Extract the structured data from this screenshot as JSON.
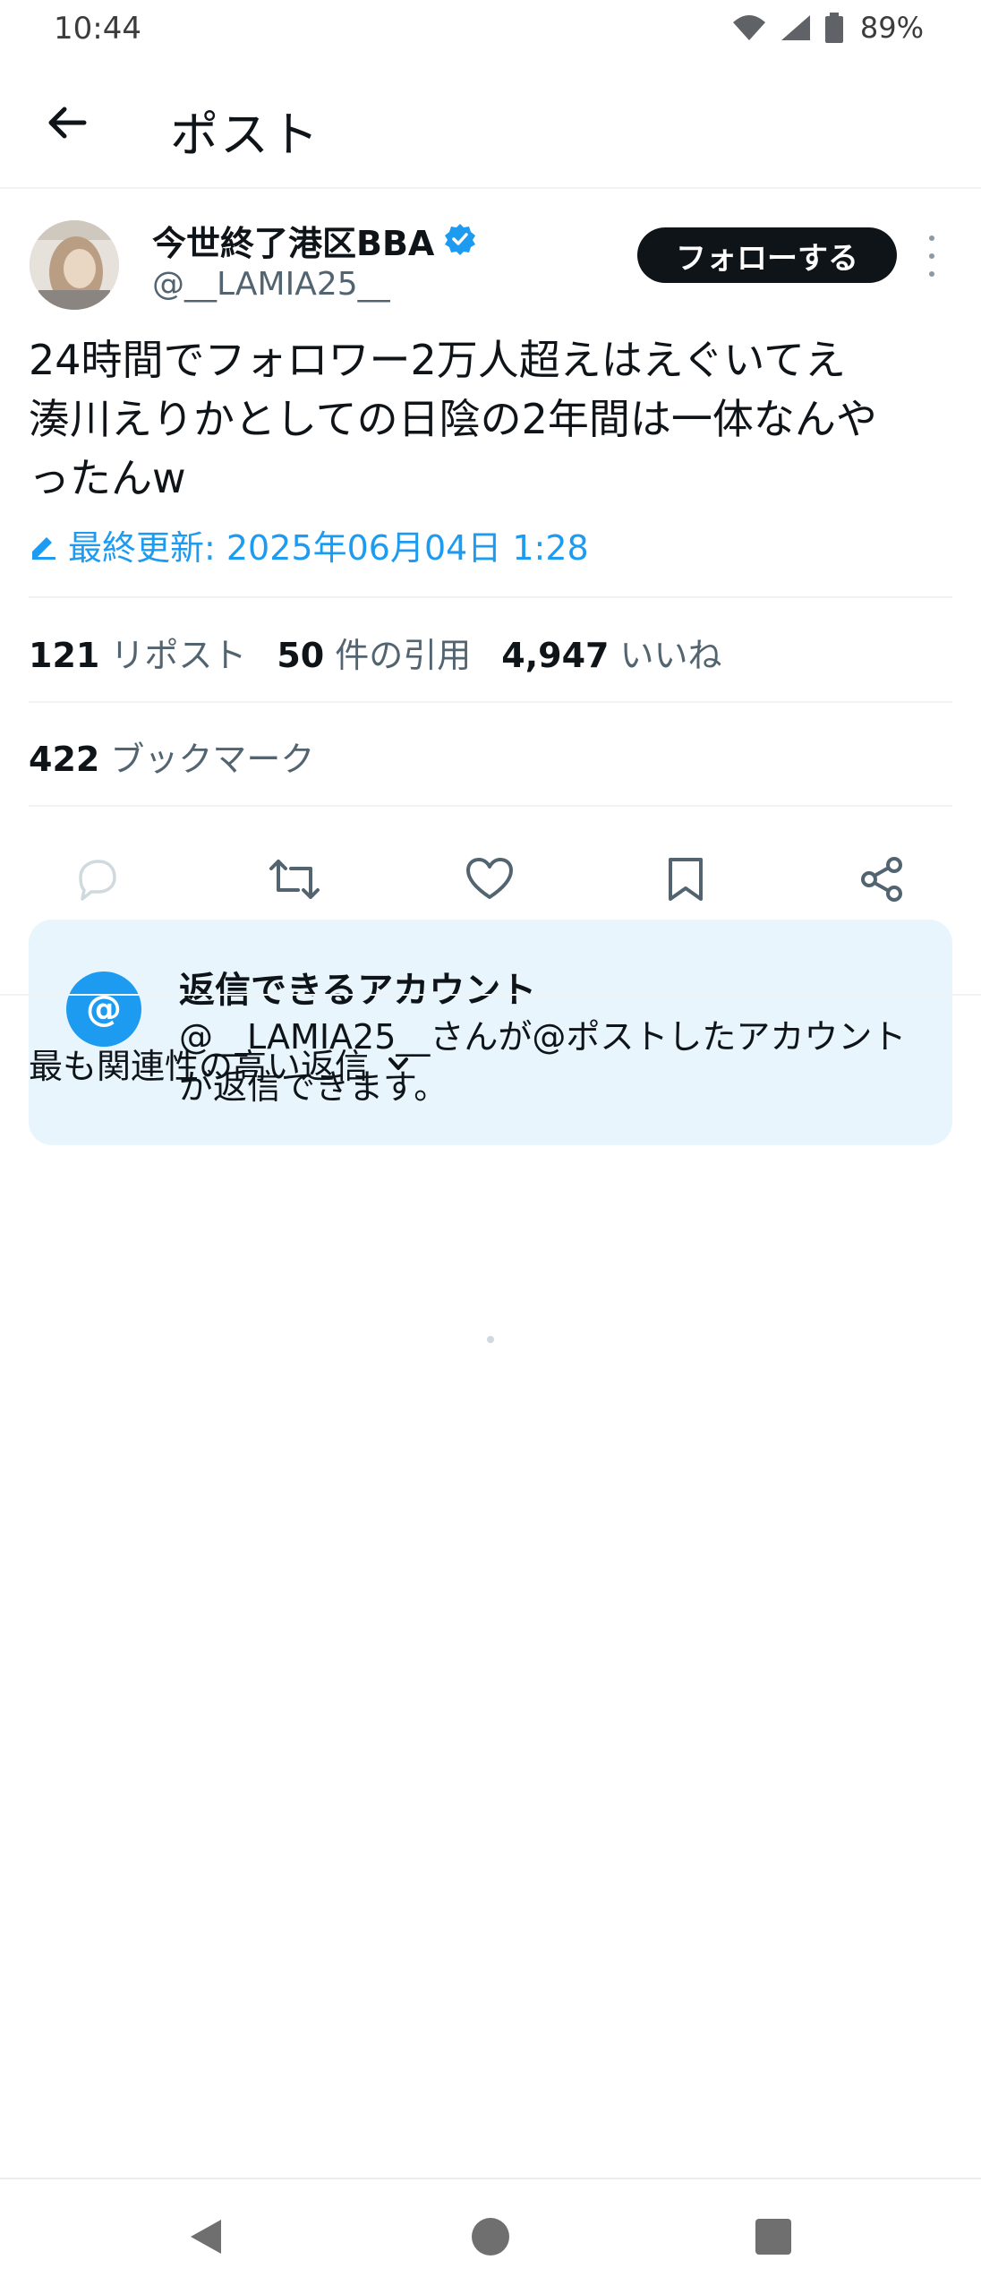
{
  "status_bar": {
    "time": "10:44",
    "battery": "89%"
  },
  "appbar": {
    "title": "ポスト",
    "back_icon": "arrow-left-icon"
  },
  "post": {
    "author_name": "今世終了港区BBA",
    "verified": true,
    "handle": "@__LAMIA25__",
    "follow_label": "フォローする",
    "text_lines": [
      "24時間でフォロワー2万人超えはえぐいてえ",
      "湊川えりかとしての日陰の2年間は一体なんや",
      "ったんw"
    ],
    "edited_label": "最終更新: 2025年06月04日 1:28",
    "stats": {
      "reposts": {
        "count": "121",
        "label": "リポスト"
      },
      "quotes": {
        "count": "50",
        "label": "件の引用"
      },
      "likes": {
        "count": "4,947",
        "label": "いいね"
      },
      "bookmarks": {
        "count": "422",
        "label": "ブックマーク"
      }
    },
    "actions": [
      "reply-icon",
      "repost-icon",
      "like-icon",
      "bookmark-icon",
      "share-icon"
    ]
  },
  "reply_restriction": {
    "icon": "@",
    "title": "返信できるアカウント",
    "description": "@__LAMIA25__さんが@ポストしたアカウントが返信できます。"
  },
  "replies": {
    "sort_label": "最も関連性の高い返信"
  },
  "colors": {
    "accent": "#1d9bf0",
    "text": "#0f1419",
    "secondary": "#536471",
    "card_bg": "#e8f5fd"
  }
}
